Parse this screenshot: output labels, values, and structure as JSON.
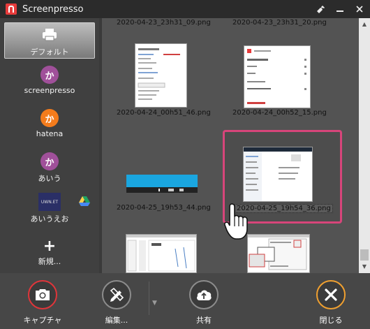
{
  "window": {
    "title": "Screenpresso"
  },
  "sidebar": {
    "items": [
      {
        "label": "デフォルト",
        "icon": "printer-icon"
      },
      {
        "label": "screenpresso",
        "icon_glyph": "か"
      },
      {
        "label": "hatena",
        "icon_glyph": "か"
      },
      {
        "label": "あいう",
        "icon_glyph": "か"
      },
      {
        "label": "あいうえお",
        "icon_text": "UWN.ET"
      },
      {
        "label": "新規...",
        "icon_glyph": "+"
      }
    ]
  },
  "gallery": {
    "files": [
      "2020-04-23_23h31_09.png",
      "2020-04-23_23h31_20.png",
      "2020-04-24_00h51_46.png",
      "2020-04-24_00h52_15.png",
      "2020-04-25_19h53_44.png",
      "2020-04-25_19h54_36.png"
    ]
  },
  "toolbar": {
    "capture_label": "キャプチャ",
    "edit_label": "編集...",
    "share_label": "共有",
    "close_label": "閉じる"
  },
  "colors": {
    "accent_red": "#e83b3b",
    "highlight_pink": "#d7457a",
    "close_orange": "#f0a030"
  }
}
